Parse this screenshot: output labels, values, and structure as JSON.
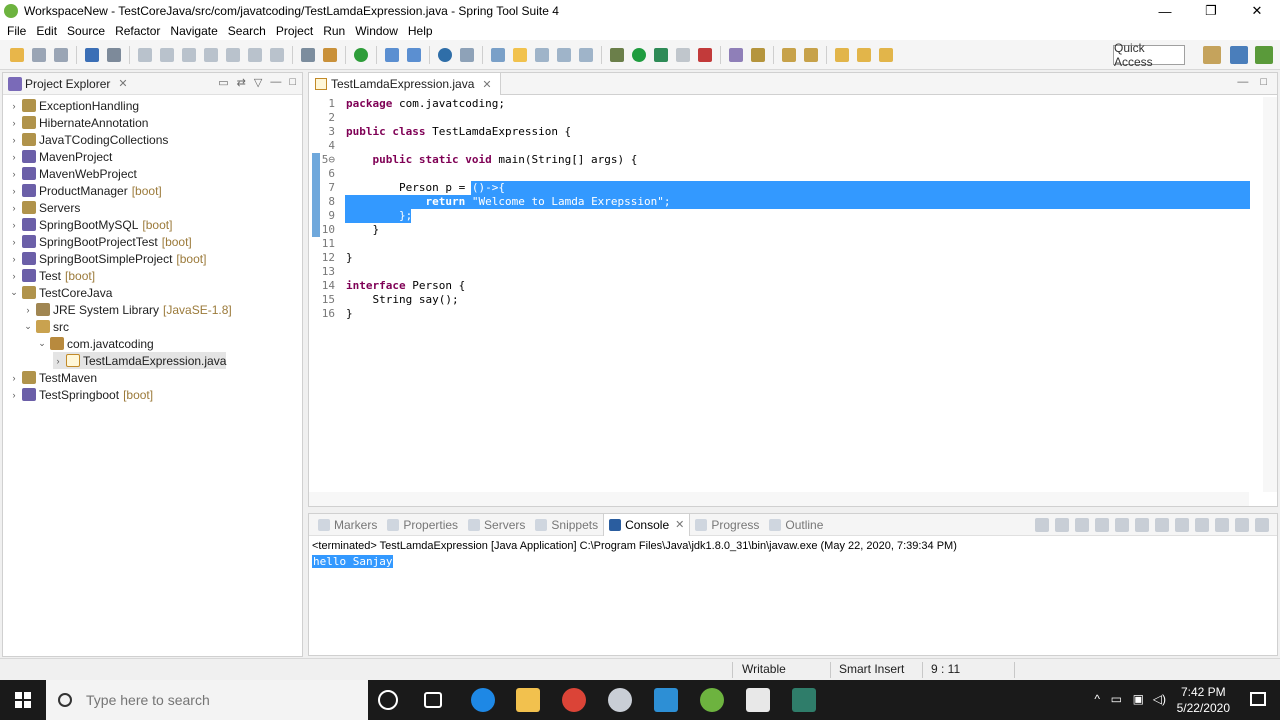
{
  "window": {
    "title": "WorkspaceNew - TestCoreJava/src/com/javatcoding/TestLamdaExpression.java - Spring Tool Suite 4",
    "minimize": "—",
    "restore": "❐",
    "close": "✕"
  },
  "menu": [
    "File",
    "Edit",
    "Source",
    "Refactor",
    "Navigate",
    "Search",
    "Project",
    "Run",
    "Window",
    "Help"
  ],
  "toolbar": {
    "quick_access": "Quick Access"
  },
  "project_explorer": {
    "title": "Project Explorer",
    "items": [
      {
        "label": "ExceptionHandling",
        "deco": ""
      },
      {
        "label": "HibernateAnnotation",
        "deco": ""
      },
      {
        "label": "JavaTCodingCollections",
        "deco": ""
      },
      {
        "label": "MavenProject",
        "deco": ""
      },
      {
        "label": "MavenWebProject",
        "deco": ""
      },
      {
        "label": "ProductManager",
        "deco": "[boot]"
      },
      {
        "label": "Servers",
        "deco": ""
      },
      {
        "label": "SpringBootMySQL",
        "deco": "[boot]"
      },
      {
        "label": "SpringBootProjectTest",
        "deco": "[boot]"
      },
      {
        "label": "SpringBootSimpleProject",
        "deco": "[boot]"
      },
      {
        "label": "Test",
        "deco": "[boot]"
      },
      {
        "label": "TestCoreJava",
        "deco": ""
      },
      {
        "label": "JRE System Library",
        "deco": "[JavaSE-1.8]"
      },
      {
        "label": "src",
        "deco": ""
      },
      {
        "label": "com.javatcoding",
        "deco": ""
      },
      {
        "label": "TestLamdaExpression.java",
        "deco": ""
      },
      {
        "label": "TestMaven",
        "deco": ""
      },
      {
        "label": "TestSpringboot",
        "deco": "[boot]"
      }
    ]
  },
  "editor": {
    "tab": "TestLamdaExpression.java",
    "lines": [
      {
        "n": "1",
        "text": "package com.javatcoding;"
      },
      {
        "n": "2",
        "text": ""
      },
      {
        "n": "3",
        "text": "public class TestLamdaExpression {"
      },
      {
        "n": "4",
        "text": ""
      },
      {
        "n": "5⊖",
        "text": "    public static void main(String[] args) {"
      },
      {
        "n": "6",
        "text": ""
      },
      {
        "n": "7",
        "text": "        Person p = ()->{"
      },
      {
        "n": "8",
        "text": "            return \"Welcome to Lamda Exrepssion\";"
      },
      {
        "n": "9",
        "text": "        };"
      },
      {
        "n": "10",
        "text": "    }"
      },
      {
        "n": "11",
        "text": ""
      },
      {
        "n": "12",
        "text": "}"
      },
      {
        "n": "13",
        "text": ""
      },
      {
        "n": "14",
        "text": "interface Person {"
      },
      {
        "n": "15",
        "text": "    String say();"
      },
      {
        "n": "16",
        "text": "}"
      }
    ]
  },
  "console": {
    "tabs": [
      "Markers",
      "Properties",
      "Servers",
      "Snippets",
      "Console",
      "Progress",
      "Outline"
    ],
    "active_tab": "Console",
    "terminated": "<terminated> TestLamdaExpression [Java Application] C:\\Program Files\\Java\\jdk1.8.0_31\\bin\\javaw.exe (May 22, 2020, 7:39:34 PM)",
    "output": "hello Sanjay"
  },
  "status": {
    "writable": "Writable",
    "insert_mode": "Smart Insert",
    "position": "9 : 11"
  },
  "taskbar": {
    "search_placeholder": "Type here to search",
    "time": "7:42 PM",
    "date": "5/22/2020"
  }
}
